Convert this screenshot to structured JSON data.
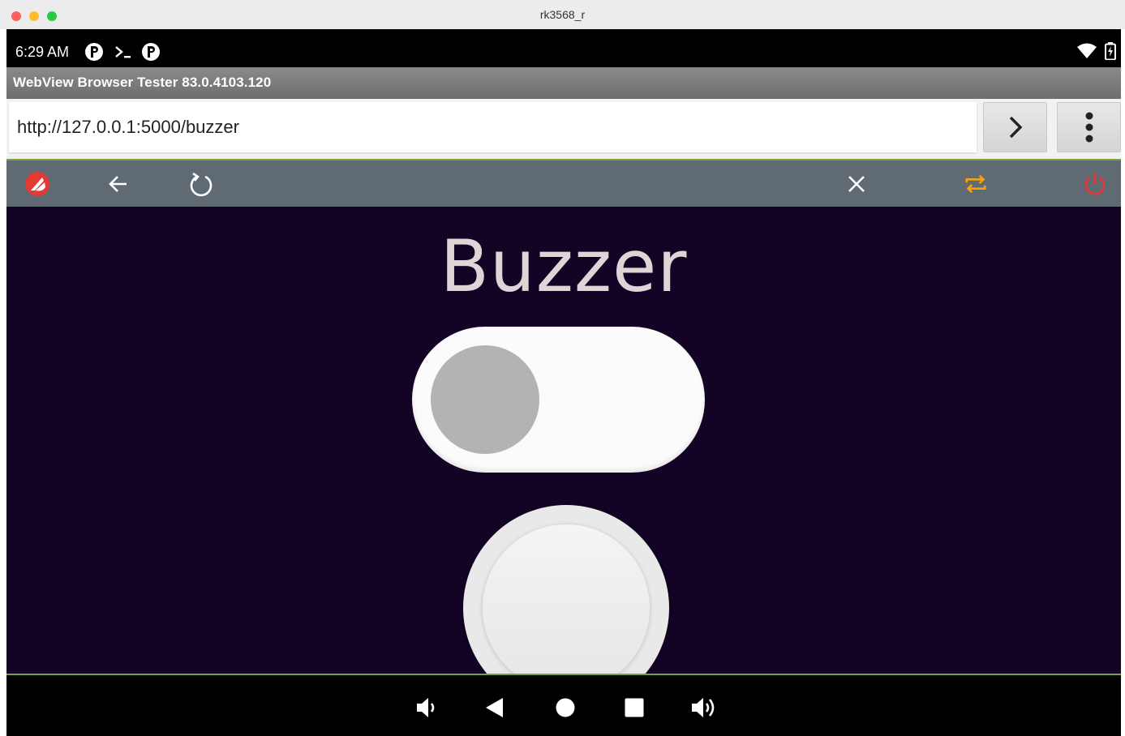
{
  "window": {
    "title": "rk3568_r"
  },
  "status_bar": {
    "time": "6:29 AM",
    "icons": [
      "notification-p-icon",
      "terminal-icon",
      "notification-p-icon",
      "wifi-icon",
      "battery-charging-icon"
    ]
  },
  "app": {
    "title": "WebView Browser Tester 83.0.4103.120"
  },
  "url_bar": {
    "value": "http://127.0.0.1:5000/buzzer"
  },
  "toolbar": {
    "icons": [
      "app-logo-icon",
      "back-arrow-icon",
      "reload-icon",
      "close-icon",
      "repeat-icon",
      "power-icon"
    ]
  },
  "page": {
    "heading": "Buzzer",
    "toggle_on": false
  },
  "nav_bar": {
    "icons": [
      "volume-down-icon",
      "back-icon",
      "home-icon",
      "recents-icon",
      "volume-up-icon"
    ]
  },
  "colors": {
    "page_bg": "#130325",
    "toolbar_bg": "#5f6a72",
    "accent_line": "#7ea33b",
    "power_red": "#e53935",
    "repeat_orange": "#f2a30f"
  }
}
